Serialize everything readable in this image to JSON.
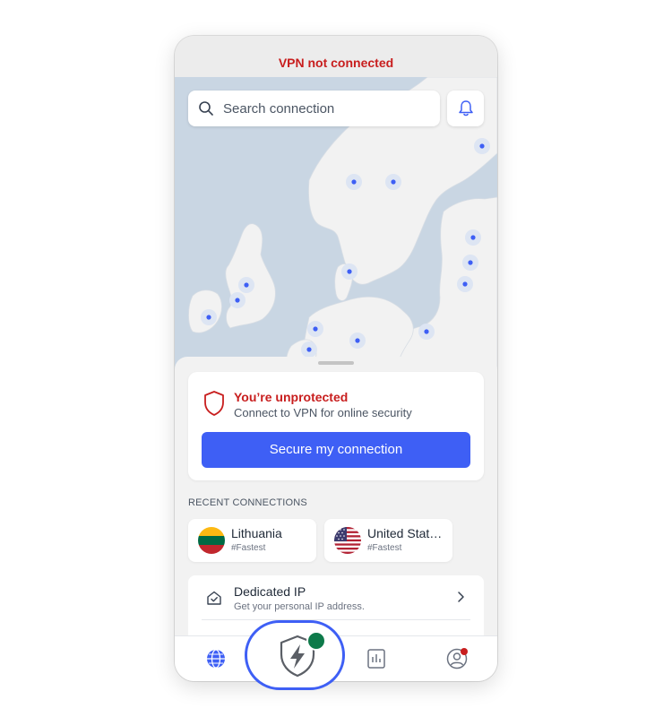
{
  "status": {
    "text": "VPN not connected",
    "color": "#c81e1e"
  },
  "search": {
    "placeholder": "Search connection"
  },
  "protection": {
    "title": "You’re unprotected",
    "subtitle": "Connect to VPN for online security",
    "button_label": "Secure my connection"
  },
  "recent": {
    "title": "RECENT CONNECTIONS",
    "items": [
      {
        "name": "Lithuania",
        "sub": "#Fastest",
        "flag": "lithuania-flag"
      },
      {
        "name": "United Stat…",
        "sub": "#Fastest",
        "flag": "us-flag"
      }
    ]
  },
  "dedicated_ip": {
    "title": "Dedicated IP",
    "subtitle": "Get your personal IP address."
  },
  "nav": {
    "items": [
      {
        "icon": "globe-icon"
      },
      {
        "icon": "stats-icon"
      },
      {
        "icon": "profile-icon",
        "badge": true
      }
    ],
    "center": {
      "icon": "shield-bolt-icon",
      "status_dot": "connected-green"
    }
  },
  "colors": {
    "accent": "#3e5ff5",
    "alert": "#c81e1e",
    "map_water": "#c9d6e3",
    "map_land": "#f2f2f2",
    "server_dot": "#3e5ff5",
    "status_dot": "#0e7a4a"
  }
}
